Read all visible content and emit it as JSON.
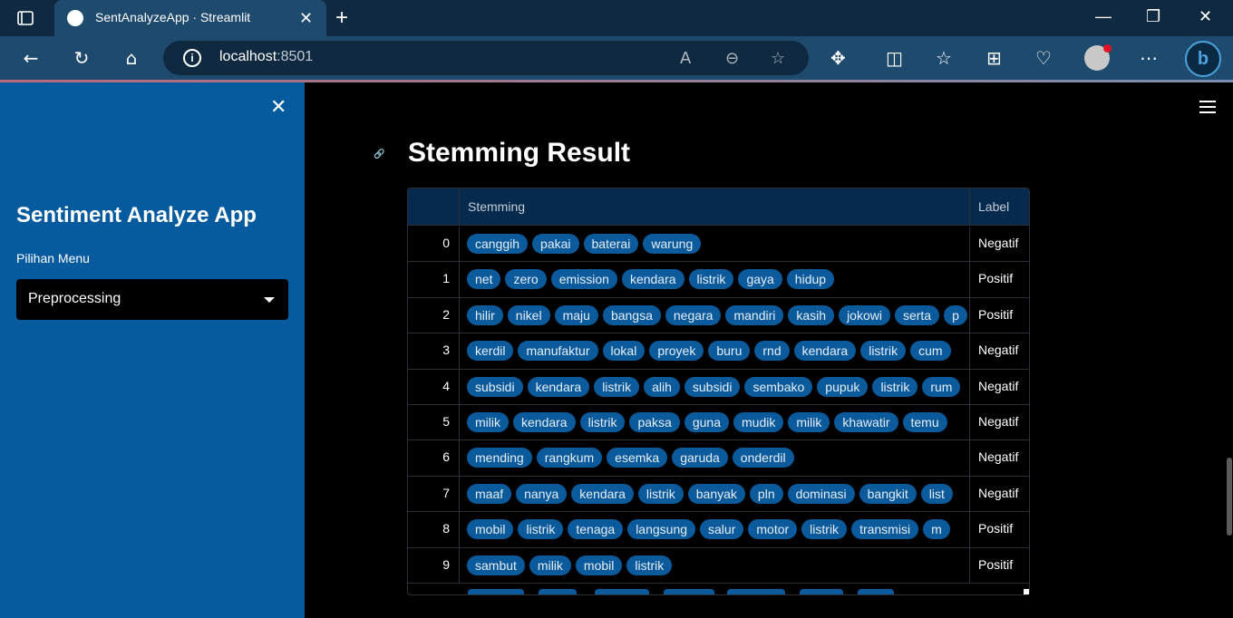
{
  "browser": {
    "tab_title": "SentAnalyzeApp · Streamlit",
    "url_host": "localhost",
    "url_port": ":8501",
    "icons": [
      "tab-list-icon",
      "back-icon",
      "refresh-icon",
      "home-icon",
      "info-icon",
      "read-aloud-icon",
      "zoom-out-icon",
      "favorite-star-icon",
      "extensions-icon",
      "split-screen-icon",
      "favorites-icon",
      "collections-icon",
      "performance-icon",
      "profile-icon",
      "more-icon",
      "bing-copilot-icon"
    ]
  },
  "sidebar": {
    "close_glyph": "✕",
    "title": "Sentiment Analyze App",
    "menu_label": "Pilihan Menu",
    "menu_selected": "Preprocessing"
  },
  "main": {
    "title": "Stemming Result",
    "columns": [
      "Stemming",
      "Label"
    ],
    "rows": [
      {
        "index": "0",
        "tokens": [
          "canggih",
          "pakai",
          "baterai",
          "warung"
        ],
        "label": "Negatif"
      },
      {
        "index": "1",
        "tokens": [
          "net",
          "zero",
          "emission",
          "kendara",
          "listrik",
          "gaya",
          "hidup"
        ],
        "label": "Positif"
      },
      {
        "index": "2",
        "tokens": [
          "hilir",
          "nikel",
          "maju",
          "bangsa",
          "negara",
          "mandiri",
          "kasih",
          "jokowi",
          "serta",
          "p"
        ],
        "label": "Positif"
      },
      {
        "index": "3",
        "tokens": [
          "kerdil",
          "manufaktur",
          "lokal",
          "proyek",
          "buru",
          "rnd",
          "kendara",
          "listrik",
          "cum"
        ],
        "label": "Negatif"
      },
      {
        "index": "4",
        "tokens": [
          "subsidi",
          "kendara",
          "listrik",
          "alih",
          "subsidi",
          "sembako",
          "pupuk",
          "listrik",
          "rum"
        ],
        "label": "Negatif"
      },
      {
        "index": "5",
        "tokens": [
          "milik",
          "kendara",
          "listrik",
          "paksa",
          "guna",
          "mudik",
          "milik",
          "khawatir",
          "temu"
        ],
        "label": "Negatif"
      },
      {
        "index": "6",
        "tokens": [
          "mending",
          "rangkum",
          "esemka",
          "garuda",
          "onderdil"
        ],
        "label": "Negatif"
      },
      {
        "index": "7",
        "tokens": [
          "maaf",
          "nanya",
          "kendara",
          "listrik",
          "banyak",
          "pln",
          "dominasi",
          "bangkit",
          "list"
        ],
        "label": "Negatif"
      },
      {
        "index": "8",
        "tokens": [
          "mobil",
          "listrik",
          "tenaga",
          "langsung",
          "salur",
          "motor",
          "listrik",
          "transmisi",
          "m"
        ],
        "label": "Positif"
      },
      {
        "index": "9",
        "tokens": [
          "sambut",
          "milik",
          "mobil",
          "listrik"
        ],
        "label": "Positif"
      }
    ]
  },
  "colors": {
    "sidebar_bg": "#065a9e",
    "chip_bg": "#0b5a9c",
    "header_bg": "#052a4d",
    "titlebar_bg": "#0f2a40"
  }
}
